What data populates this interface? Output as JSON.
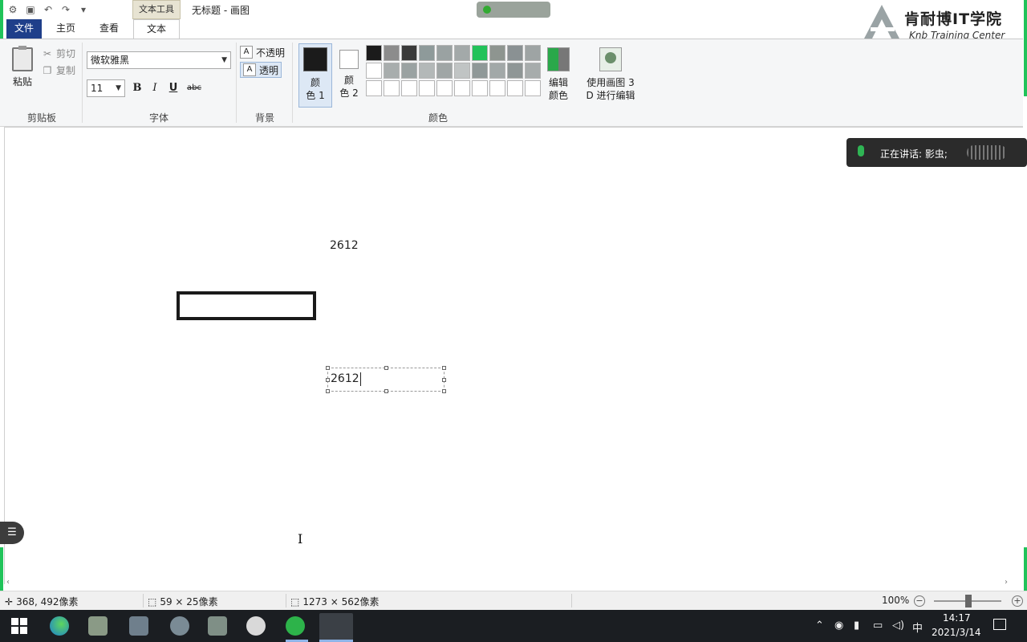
{
  "window": {
    "title": "无标题 - 画图",
    "context_tab": "文本工具"
  },
  "logo": {
    "cn": "肯耐博IT学院",
    "en": "Knb  Training Center"
  },
  "tabs": [
    {
      "label": "文件"
    },
    {
      "label": "主页"
    },
    {
      "label": "查看"
    },
    {
      "label": "文本"
    }
  ],
  "clipboard": {
    "paste": "粘贴",
    "cut": "剪切",
    "copy": "复制",
    "group": "剪贴板"
  },
  "font": {
    "name": "微软雅黑",
    "size": "11",
    "bold": "B",
    "italic": "I",
    "underline": "U",
    "strike": "abc",
    "group": "字体"
  },
  "background": {
    "opaque": "不透明",
    "transparent": "透明",
    "group": "背景"
  },
  "colors": {
    "color1_a": "颜",
    "color1_b": "色 1",
    "color2_a": "颜",
    "color2_b": "色 2",
    "edit_a": "编辑",
    "edit_b": "颜色",
    "p3d_a": "使用画图 3",
    "p3d_b": "D 进行编辑",
    "group": "颜色",
    "color1_value": "#1b1b1b",
    "color2_value": "#ffffff",
    "palette_row1": [
      "#1b1b1b",
      "#8c8c8c",
      "#3a3a3a",
      "#8e9a9a",
      "#9aa2a2",
      "#a3a9a9",
      "#22c25a",
      "#8e9590",
      "#8a9193",
      "#9ea4a4"
    ],
    "palette_row2": [
      "#ffffff",
      "#a8adad",
      "#9aa2a2",
      "#b3b8b8",
      "#a0a6a6",
      "#c0c4c4",
      "#8f9898",
      "#a2a8a8",
      "#8f9696",
      "#a7acac"
    ],
    "palette_row3": [
      "#ffffff",
      "#ffffff",
      "#ffffff",
      "#ffffff",
      "#ffffff",
      "#ffffff",
      "#ffffff",
      "#ffffff",
      "#ffffff",
      "#ffffff"
    ]
  },
  "canvas": {
    "text_top": "2612",
    "text_box": "2612"
  },
  "speaking": {
    "label": "正在讲话: 影虫;"
  },
  "status": {
    "cursor_pos": "368, 492像素",
    "selection_size": "59 × 25像素",
    "canvas_size": "1273 × 562像素",
    "zoom": "100%"
  },
  "taskbar": {
    "time": "14:17",
    "date": "2021/3/14",
    "ime": "中"
  }
}
